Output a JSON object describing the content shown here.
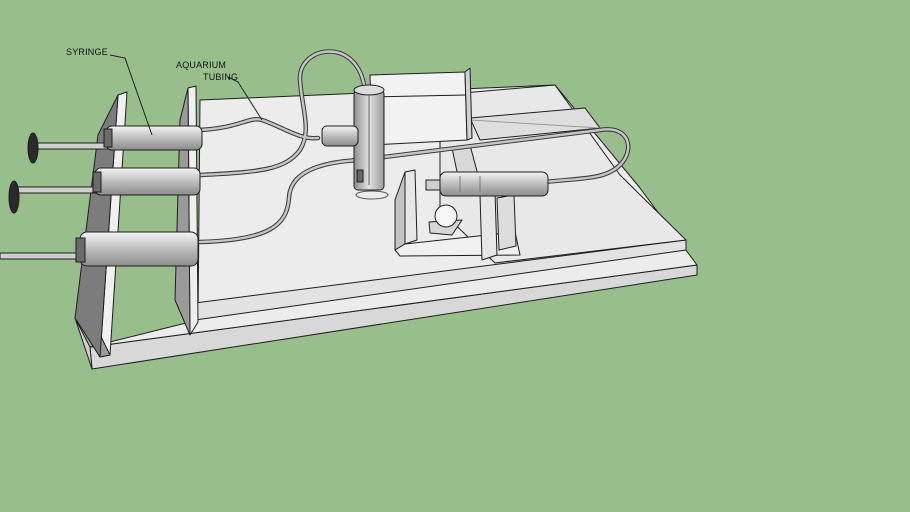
{
  "scene": {
    "background": "#98be8c",
    "model_fill": "#ececec",
    "model_shade": "#d2d2d2",
    "model_dark": "#7a7a7a",
    "edge": "#1e1e1e"
  },
  "callouts": {
    "syringe": "SYRINGE",
    "tubing_line1": "AQUARIUM",
    "tubing_line2": "TUBING"
  }
}
